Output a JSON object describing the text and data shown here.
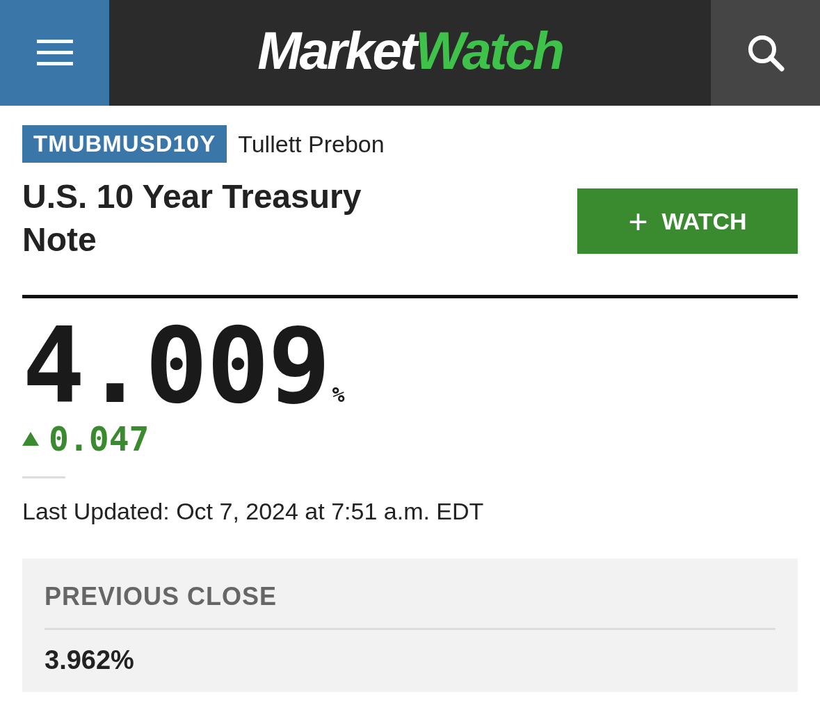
{
  "header": {
    "logo": {
      "part_1": "Market",
      "part_2": "Watch"
    }
  },
  "quote": {
    "ticker": "TMUBMUSD10Y",
    "source": "Tullett Prebon",
    "title": "U.S. 10 Year Treasury Note",
    "watch_button": {
      "icon": "+",
      "label": "WATCH"
    },
    "price": "4.009",
    "unit": "%",
    "change": {
      "rising": true,
      "value": "0.047"
    },
    "last_updated": "Last Updated: Oct 7, 2024 at 7:51 a.m. EDT"
  },
  "previous_close": {
    "label": "PREVIOUS CLOSE",
    "value": "3.962%"
  }
}
